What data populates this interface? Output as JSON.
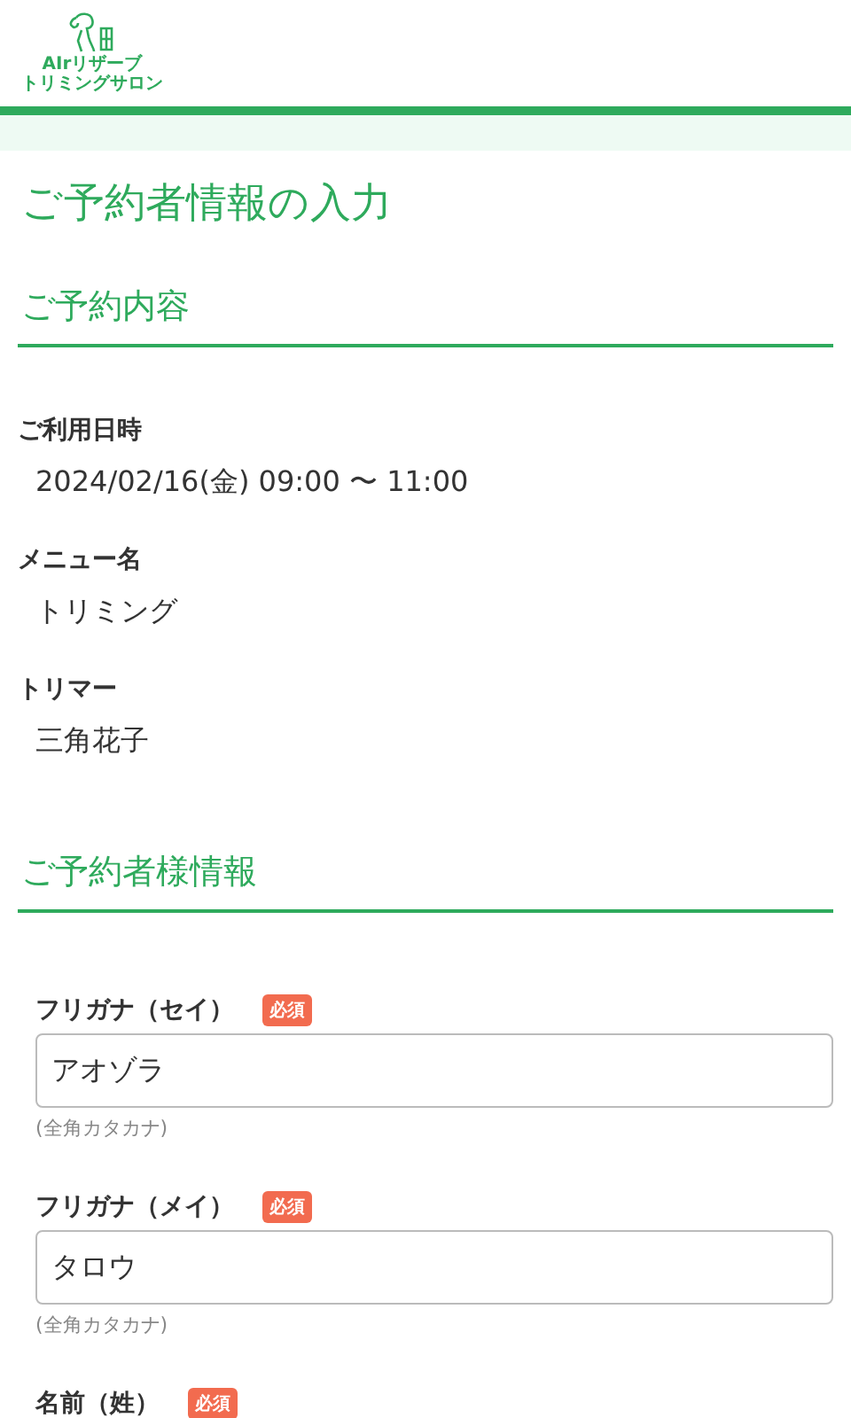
{
  "logo": {
    "line_1": "AIrリザーブ",
    "line_2": "トリミングサロン"
  },
  "page_title": "ご予約者情報の入力",
  "reservation": {
    "heading": "ご予約内容",
    "items": [
      {
        "label": "ご利用日時",
        "value": "2024/02/16(金) 09:00 〜 11:00"
      },
      {
        "label": "メニュー名",
        "value": "トリミング"
      },
      {
        "label": "トリマー",
        "value": "三角花子"
      }
    ]
  },
  "customer": {
    "heading": "ご予約者様情報",
    "fields": [
      {
        "label": "フリガナ（セイ）",
        "badge": "必須",
        "value": "アオゾラ",
        "hint": "(全角カタカナ)"
      },
      {
        "label": "フリガナ（メイ）",
        "badge": "必須",
        "value": "タロウ",
        "hint": "(全角カタカナ)"
      },
      {
        "label": "名前（姓）",
        "badge": "必須"
      }
    ]
  }
}
